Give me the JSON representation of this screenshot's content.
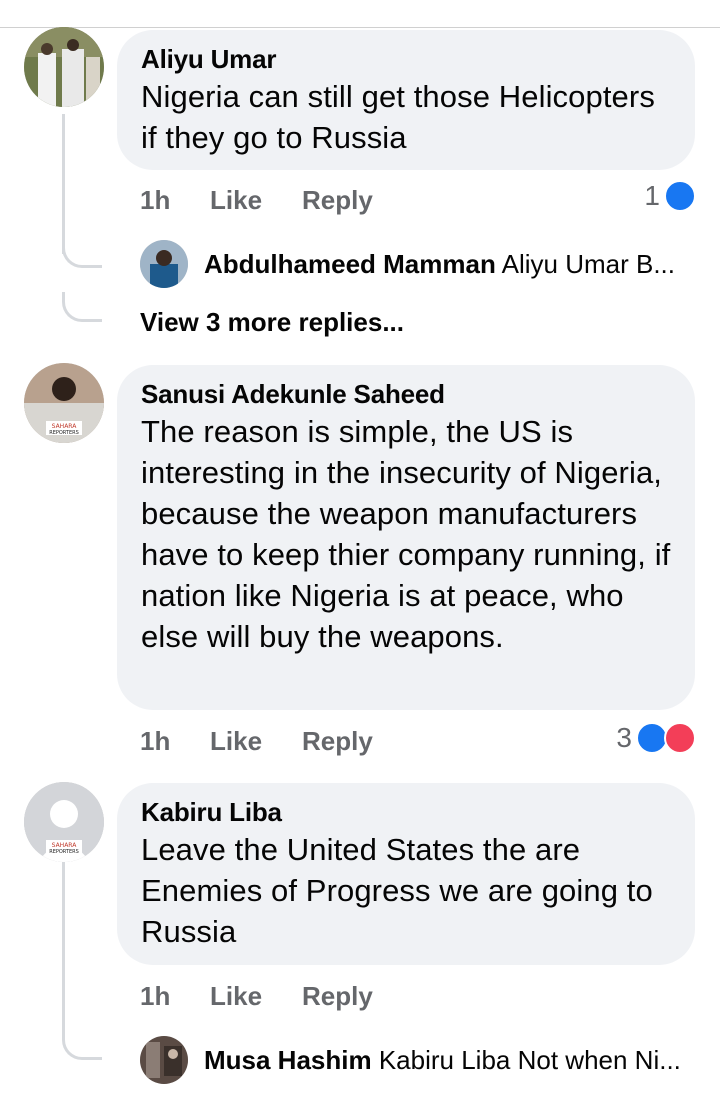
{
  "comments": [
    {
      "author": "Aliyu Umar",
      "text": "Nigeria can still get those Helicopters if they go to Russia",
      "time": "1h",
      "like_label": "Like",
      "reply_label": "Reply",
      "reaction_count": "1",
      "reply_preview": {
        "author": "Abdulhameed Mamman",
        "text": "Aliyu Umar B..."
      },
      "more_replies": "View 3 more replies..."
    },
    {
      "author": "Sanusi Adekunle Saheed",
      "text": "The reason is simple, the US is interesting in the insecurity of Nigeria, because the weapon manufacturers have to keep thier company running, if nation like Nigeria is at peace, who else will buy the weapons.",
      "time": "1h",
      "like_label": "Like",
      "reply_label": "Reply",
      "reaction_count": "3",
      "avatar_watermark": "SAHARA REPORTERS"
    },
    {
      "author": "Kabiru Liba",
      "text": "Leave the United States the are Enemies of Progress  we are going to Russia",
      "time": "1h",
      "like_label": "Like",
      "reply_label": "Reply",
      "avatar_watermark": "SAHARA REPORTERS",
      "reply_preview": {
        "author": "Musa Hashim",
        "text": "Kabiru Liba  Not when Ni..."
      }
    }
  ],
  "colors": {
    "like": "#1877f2",
    "love": "#f33e58",
    "bubble": "#f0f2f5",
    "meta": "#65676b"
  }
}
